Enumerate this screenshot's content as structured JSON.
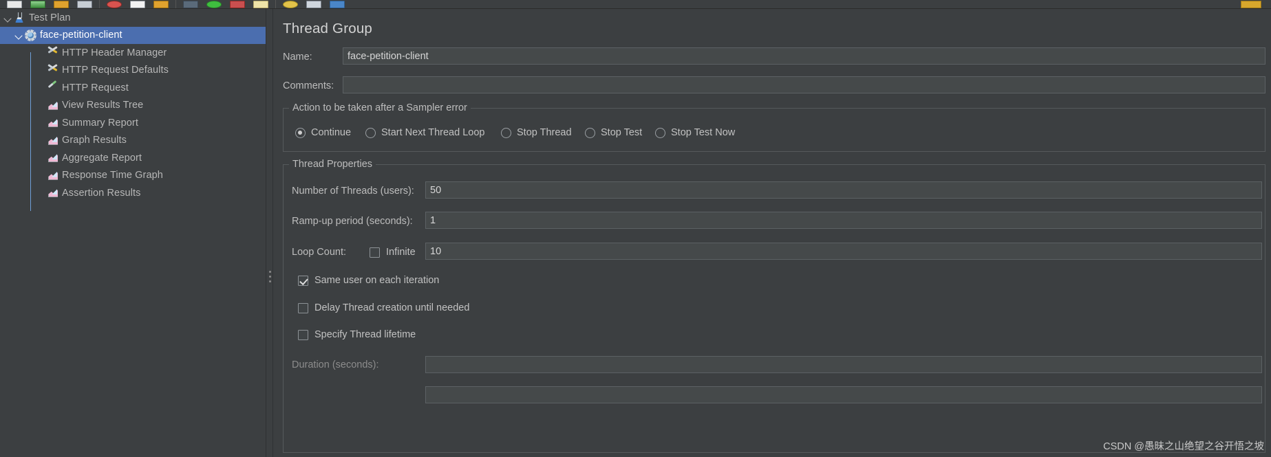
{
  "window": {
    "bg_color": "#3c3f41",
    "selection_color": "#4b6eaf"
  },
  "toolbar": {
    "items": [
      {
        "name": "new-button",
        "icon": "new-file-icon"
      },
      {
        "name": "templates-button",
        "icon": "templates-icon"
      },
      {
        "name": "open-button",
        "icon": "open-folder-icon"
      },
      {
        "name": "save-button",
        "icon": "save-disk-icon"
      },
      {
        "name": "cut-button",
        "icon": "cut-icon"
      },
      {
        "name": "copy-button",
        "icon": "copy-icon"
      },
      {
        "name": "paste-button",
        "icon": "paste-icon"
      },
      {
        "name": "undo-button",
        "icon": "undo-arrow-icon"
      },
      {
        "name": "start-button",
        "icon": "run-play-icon"
      },
      {
        "name": "stop-button",
        "icon": "stop-square-icon"
      },
      {
        "name": "clear-button",
        "icon": "clear-broom-icon"
      },
      {
        "name": "help-button",
        "icon": "help-bulb-icon"
      },
      {
        "name": "screenshot-button",
        "icon": "image-icon"
      },
      {
        "name": "function-helper-button",
        "icon": "blue-square-icon"
      }
    ]
  },
  "tree": {
    "nodes": [
      {
        "label": "Test Plan",
        "icon": "test-plan-icon",
        "depth": 0,
        "expanded": true,
        "selected": false
      },
      {
        "label": "face-petition-client",
        "icon": "thread-group-gear-icon",
        "depth": 1,
        "expanded": true,
        "selected": true
      },
      {
        "label": "HTTP Header Manager",
        "icon": "config-element-icon",
        "depth": 2,
        "expanded": false,
        "selected": false
      },
      {
        "label": "HTTP Request Defaults",
        "icon": "config-element-icon",
        "depth": 2,
        "expanded": false,
        "selected": false
      },
      {
        "label": "HTTP Request",
        "icon": "sampler-icon",
        "depth": 2,
        "expanded": false,
        "selected": false
      },
      {
        "label": "View Results Tree",
        "icon": "listener-icon",
        "depth": 2,
        "expanded": false,
        "selected": false
      },
      {
        "label": "Summary Report",
        "icon": "listener-icon",
        "depth": 2,
        "expanded": false,
        "selected": false
      },
      {
        "label": "Graph Results",
        "icon": "listener-icon",
        "depth": 2,
        "expanded": false,
        "selected": false
      },
      {
        "label": "Aggregate Report",
        "icon": "listener-icon",
        "depth": 2,
        "expanded": false,
        "selected": false
      },
      {
        "label": "Response Time Graph",
        "icon": "listener-icon",
        "depth": 2,
        "expanded": false,
        "selected": false
      },
      {
        "label": "Assertion Results",
        "icon": "listener-icon",
        "depth": 2,
        "expanded": false,
        "selected": false
      }
    ]
  },
  "main": {
    "title": "Thread Group",
    "name_label": "Name:",
    "name_value": "face-petition-client",
    "comments_label": "Comments:",
    "comments_value": "",
    "sampler_error": {
      "group_title": "Action to be taken after a Sampler error",
      "options": [
        {
          "label": "Continue",
          "selected": true
        },
        {
          "label": "Start Next Thread Loop",
          "selected": false
        },
        {
          "label": "Stop Thread",
          "selected": false
        },
        {
          "label": "Stop Test",
          "selected": false
        },
        {
          "label": "Stop Test Now",
          "selected": false
        }
      ]
    },
    "thread_properties": {
      "group_title": "Thread Properties",
      "num_threads_label": "Number of Threads (users):",
      "num_threads_value": "50",
      "rampup_label": "Ramp-up period (seconds):",
      "rampup_value": "1",
      "loop_count_label": "Loop Count:",
      "infinite_label": "Infinite",
      "infinite_checked": false,
      "loop_count_value": "10",
      "checkboxes": [
        {
          "label": "Same user on each iteration",
          "checked": true
        },
        {
          "label": "Delay Thread creation until needed",
          "checked": false
        },
        {
          "label": "Specify Thread lifetime",
          "checked": false
        }
      ],
      "duration_label": "Duration (seconds):",
      "duration_value": ""
    }
  },
  "watermark": "CSDN @愚昧之山绝望之谷开悟之坡"
}
